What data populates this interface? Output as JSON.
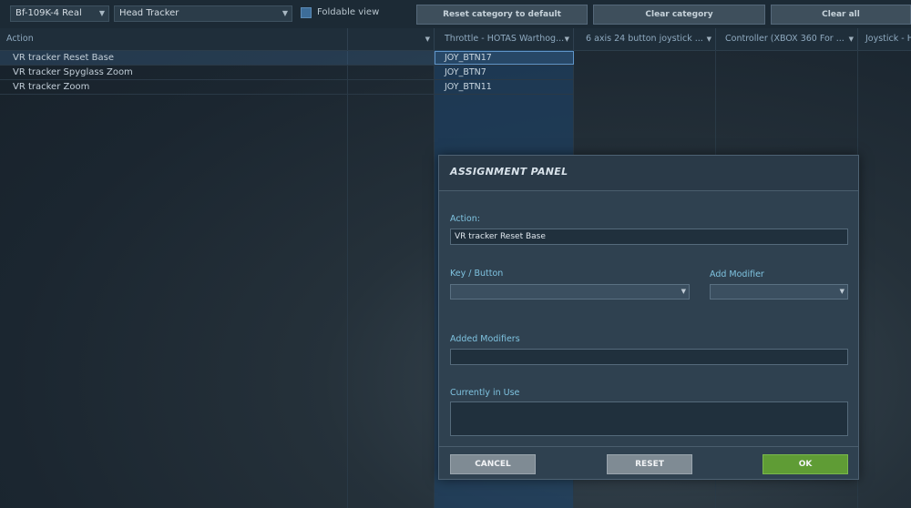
{
  "toolbar": {
    "aircraft": "Bf-109K-4 Real",
    "category": "Head Tracker",
    "foldable_label": "Foldable view",
    "reset_category": "Reset category to default",
    "clear_category": "Clear category",
    "clear_all": "Clear all"
  },
  "columns": {
    "action": "Action",
    "c1": "Throttle - HOTAS Warthog...",
    "c2": "6 axis 24 button joystick ...",
    "c3": "Controller (XBOX 360 For ...",
    "c4": "Joystick - H"
  },
  "rows": [
    {
      "name": "VR tracker Reset Base",
      "assign": "JOY_BTN17"
    },
    {
      "name": "VR tracker Spyglass Zoom",
      "assign": "JOY_BTN7"
    },
    {
      "name": "VR tracker Zoom",
      "assign": "JOY_BTN11"
    }
  ],
  "modal": {
    "title": "ASSIGNMENT PANEL",
    "action_label": "Action:",
    "action_value": "VR tracker Reset Base",
    "key_label": "Key / Button",
    "modifier_label": "Add Modifier",
    "added_label": "Added Modifiers",
    "inuse_label": "Currently in Use",
    "cancel": "CANCEL",
    "reset": "RESET",
    "ok": "OK"
  },
  "colors": {
    "ok_button": "#5f9c35",
    "label_accent": "#7fc3e0",
    "selected_column": "#1e466e"
  }
}
